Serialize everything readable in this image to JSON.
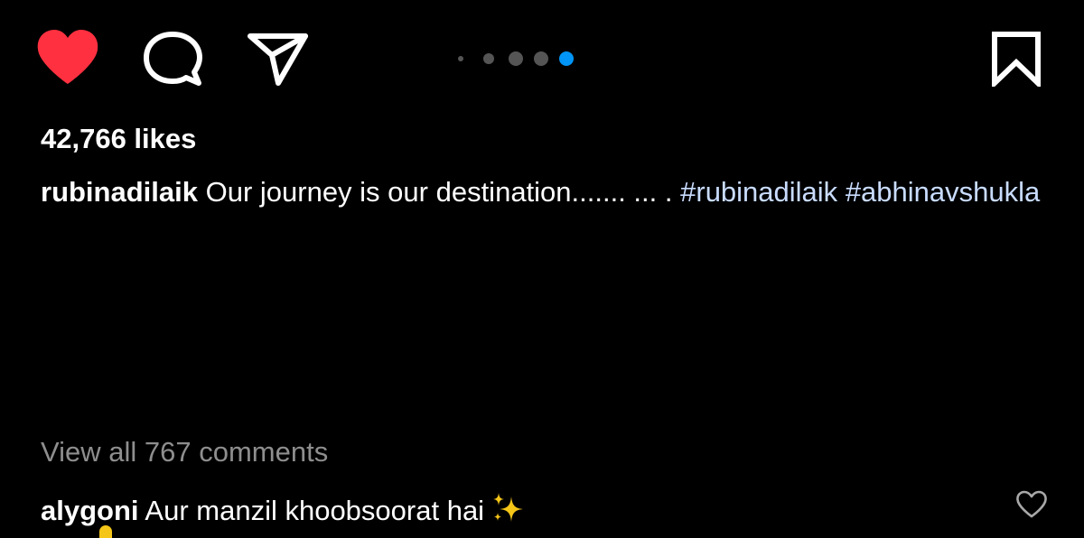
{
  "actions": {
    "like_icon": "heart-filled-icon",
    "like_color": "#ff3040",
    "comment_icon": "speech-bubble-icon",
    "share_icon": "paper-plane-icon",
    "save_icon": "bookmark-icon"
  },
  "carousel": {
    "total": 5,
    "active_index": 4,
    "active_color": "#0095f6",
    "inactive_color": "#555555"
  },
  "post": {
    "likes": "42,766 likes",
    "caption": {
      "username": "rubinadilaik",
      "text": " Our journey is our destination....... ... . ",
      "hashtags": [
        "#rubinadilaik",
        "#abhinavshukla"
      ]
    }
  },
  "comments": {
    "view_all": "View all 767 comments",
    "items": [
      {
        "username": "alygoni",
        "text": " Aur manzil khoobsoorat hai",
        "emoji": "sparkles-icon",
        "like_icon": "heart-outline-icon"
      }
    ]
  }
}
